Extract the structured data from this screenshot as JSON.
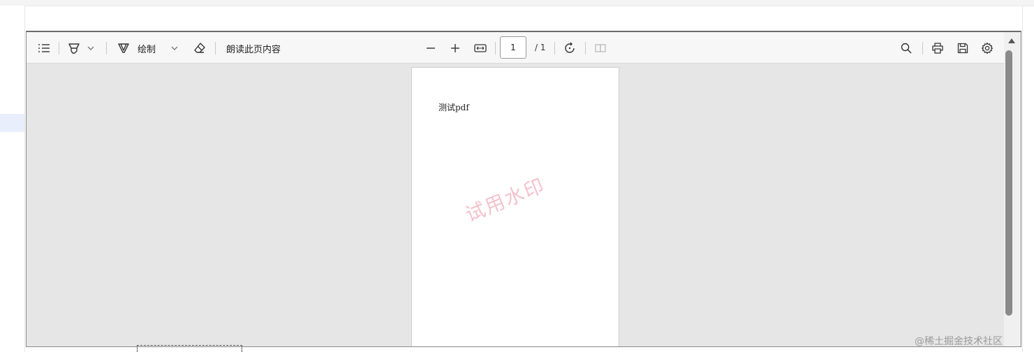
{
  "toolbar": {
    "draw_label": "绘制",
    "read_aloud_label": "朗读此页内容",
    "page_value": "1",
    "page_total": "/ 1"
  },
  "icons": {
    "contents": "list-icon",
    "highlight": "highlighter-icon",
    "draw": "draw-pen-icon",
    "erase": "eraser-icon",
    "zoom_out": "minus-icon",
    "zoom_in": "plus-icon",
    "fit": "fit-width-icon",
    "rotate": "rotate-icon",
    "view": "page-view-icon",
    "find": "search-icon",
    "print": "printer-icon",
    "save": "save-icon",
    "settings": "gear-icon"
  },
  "document": {
    "text": "测试pdf",
    "watermark": "试用水印"
  },
  "footer": {
    "credit": "@稀土掘金技术社区"
  },
  "colors": {
    "viewer_bg": "#e6e6e6",
    "toolbar_bg": "#f7f7f7",
    "watermark": "#e6788c"
  }
}
